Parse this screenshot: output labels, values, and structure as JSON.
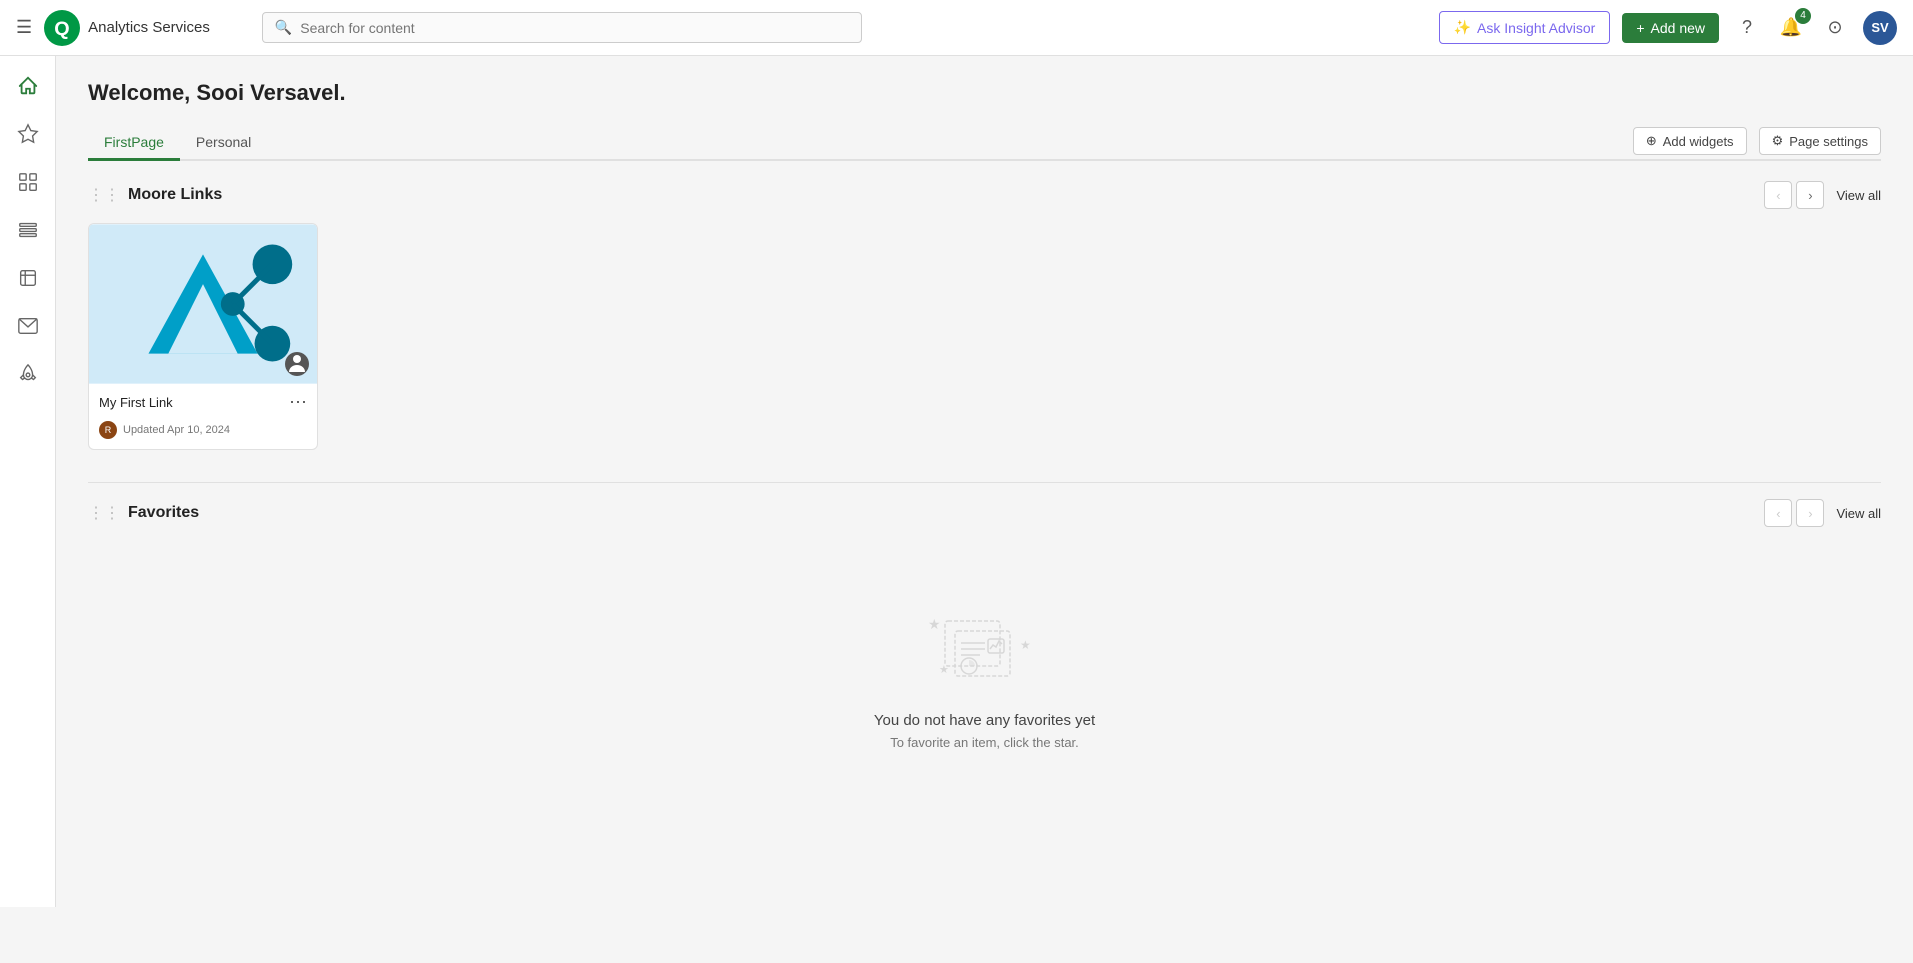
{
  "app": {
    "name": "Analytics Services"
  },
  "topnav": {
    "search_placeholder": "Search for content",
    "insight_label": "Ask Insight Advisor",
    "addnew_label": "Add new",
    "badge_count": "4",
    "avatar_initials": "SV"
  },
  "sidebar": {
    "items": [
      {
        "name": "home",
        "icon": "⌂",
        "active": true
      },
      {
        "name": "favorites",
        "icon": "☆",
        "active": false
      },
      {
        "name": "catalog",
        "icon": "▦",
        "active": false
      },
      {
        "name": "collections",
        "icon": "⊟",
        "active": false
      },
      {
        "name": "alerts",
        "icon": "◻",
        "active": false
      },
      {
        "name": "subscriptions",
        "icon": "✉",
        "active": false
      },
      {
        "name": "automations",
        "icon": "🚀",
        "active": false
      }
    ]
  },
  "main": {
    "welcome": "Welcome, Sooi Versavel.",
    "tabs": [
      {
        "id": "firstpage",
        "label": "FirstPage",
        "active": true
      },
      {
        "id": "personal",
        "label": "Personal",
        "active": false
      }
    ],
    "add_widgets_label": "Add widgets",
    "page_settings_label": "Page settings",
    "sections": [
      {
        "id": "moore-links",
        "title": "Moore Links",
        "view_all": "View all",
        "cards": [
          {
            "name": "My First Link",
            "updated": "Updated Apr 10, 2024",
            "avatar_initials": "R"
          }
        ]
      },
      {
        "id": "favorites",
        "title": "Favorites",
        "view_all": "View all",
        "empty": true,
        "empty_title": "You do not have any favorites yet",
        "empty_sub": "To favorite an item, click the star."
      }
    ]
  }
}
